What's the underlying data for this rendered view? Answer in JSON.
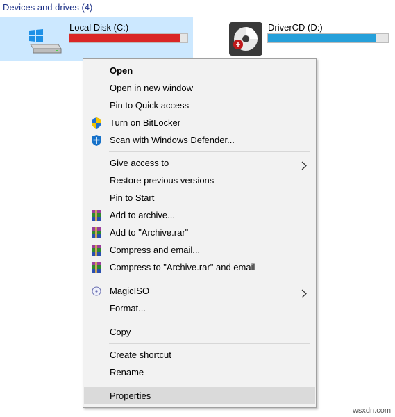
{
  "header": {
    "group_title": "Devices and drives (4)"
  },
  "drives": [
    {
      "name": "Local Disk (C:)",
      "icon": "windows-drive-icon",
      "usage_fraction": 0.94,
      "bar_color": "#da2626",
      "selected": true
    },
    {
      "name": "DriverCD (D:)",
      "icon": "optical-disc-icon",
      "usage_fraction": 0.9,
      "bar_color": "#26a0da",
      "selected": false
    }
  ],
  "menu": {
    "items": [
      {
        "label": "Open",
        "bold": true,
        "icon": null,
        "submenu": false
      },
      {
        "label": "Open in new window",
        "icon": null,
        "submenu": false
      },
      {
        "label": "Pin to Quick access",
        "icon": null,
        "submenu": false
      },
      {
        "label": "Turn on BitLocker",
        "icon": "shield-icon",
        "submenu": false
      },
      {
        "label": "Scan with Windows Defender...",
        "icon": "defender-icon",
        "submenu": false
      },
      {
        "label": "Give access to",
        "icon": null,
        "submenu": true
      },
      {
        "label": "Restore previous versions",
        "icon": null,
        "submenu": false
      },
      {
        "label": "Pin to Start",
        "icon": null,
        "submenu": false
      },
      {
        "label": "Add to archive...",
        "icon": "winrar-icon",
        "submenu": false
      },
      {
        "label": "Add to \"Archive.rar\"",
        "icon": "winrar-icon",
        "submenu": false
      },
      {
        "label": "Compress and email...",
        "icon": "winrar-icon",
        "submenu": false
      },
      {
        "label": "Compress to \"Archive.rar\" and email",
        "icon": "winrar-icon",
        "submenu": false
      },
      {
        "label": "MagicISO",
        "icon": "magiciso-icon",
        "submenu": true
      },
      {
        "label": "Format...",
        "icon": null,
        "submenu": false
      },
      {
        "label": "Copy",
        "icon": null,
        "submenu": false
      },
      {
        "label": "Create shortcut",
        "icon": null,
        "submenu": false
      },
      {
        "label": "Rename",
        "icon": null,
        "submenu": false
      },
      {
        "label": "Properties",
        "icon": null,
        "submenu": false,
        "highlighted": true
      }
    ]
  },
  "watermark": "wsxdn.com",
  "colors": {
    "accent": "#cce8ff",
    "header": "#1e3287",
    "menu_bg": "#f2f2f2",
    "highlight": "#dadada"
  }
}
